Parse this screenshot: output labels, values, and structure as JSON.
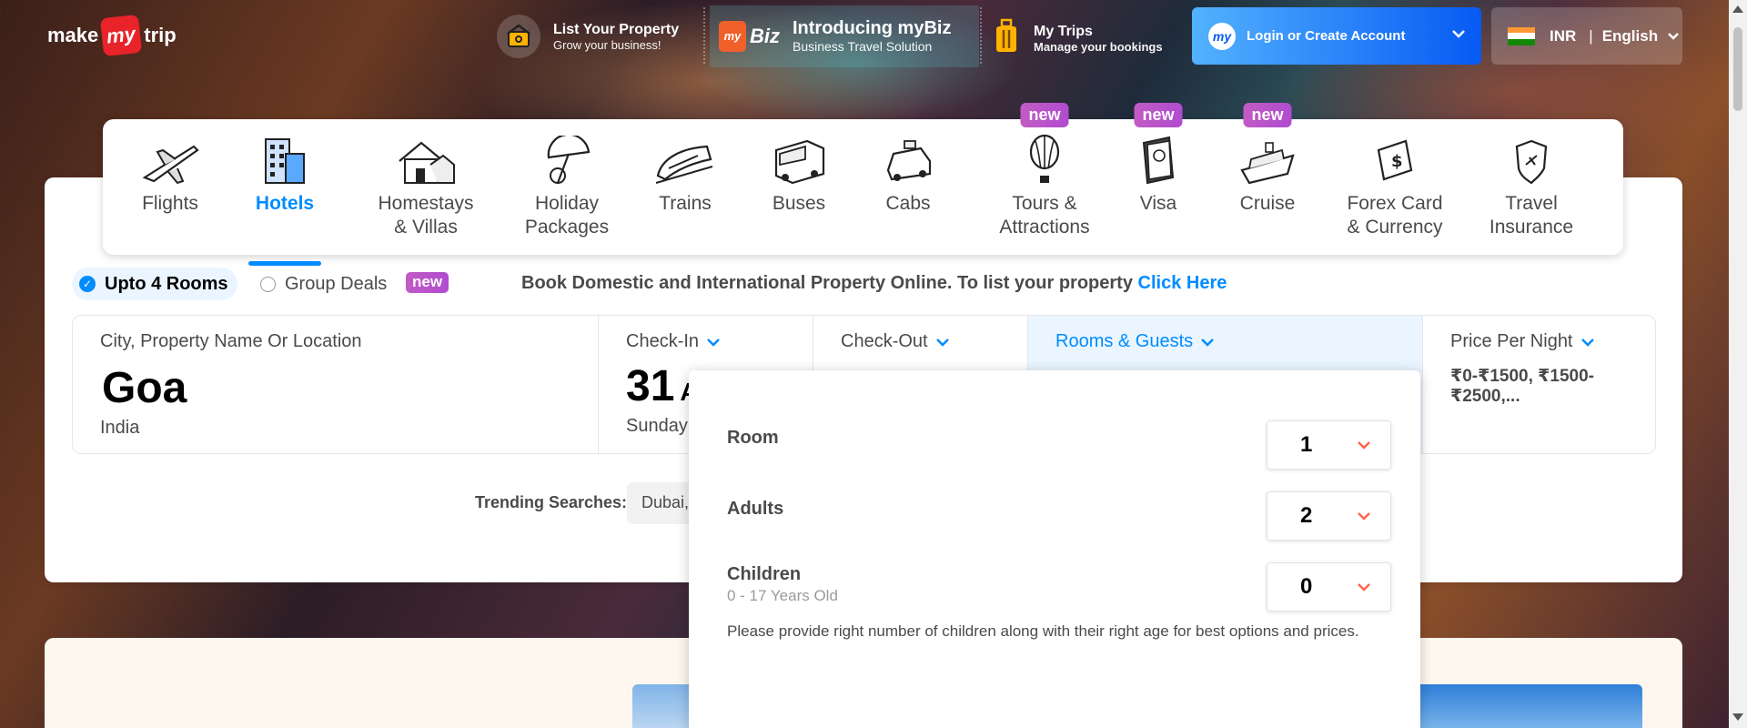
{
  "header": {
    "logo_left": "make",
    "logo_mid": "my",
    "logo_right": "trip",
    "list_property": {
      "title": "List Your Property",
      "subtitle": "Grow your business!"
    },
    "mybiz": {
      "badge": "Biz",
      "title": "Introducing myBiz",
      "subtitle": "Business Travel Solution"
    },
    "my_trips": {
      "title": "My Trips",
      "subtitle": "Manage your bookings"
    },
    "login": {
      "label": "Login or Create Account",
      "icon_text": "my"
    },
    "locale": {
      "currency": "INR",
      "separator": "|",
      "language": "English"
    }
  },
  "nav": {
    "items": [
      {
        "label1": "Flights",
        "label2": "",
        "icon": "plane-icon"
      },
      {
        "label1": "Hotels",
        "label2": "",
        "icon": "hotel-icon"
      },
      {
        "label1": "Homestays",
        "label2": "& Villas",
        "icon": "house-icon"
      },
      {
        "label1": "Holiday",
        "label2": "Packages",
        "icon": "umbrella-icon"
      },
      {
        "label1": "Trains",
        "label2": "",
        "icon": "train-icon"
      },
      {
        "label1": "Buses",
        "label2": "",
        "icon": "bus-icon"
      },
      {
        "label1": "Cabs",
        "label2": "",
        "icon": "cab-icon"
      },
      {
        "label1": "Tours &",
        "label2": "Attractions",
        "icon": "balloon-icon",
        "badge": "new"
      },
      {
        "label1": "Visa",
        "label2": "",
        "icon": "passport-icon",
        "badge": "new"
      },
      {
        "label1": "Cruise",
        "label2": "",
        "icon": "cruise-icon",
        "badge": "new"
      },
      {
        "label1": "Forex Card",
        "label2": "& Currency",
        "icon": "forex-icon"
      },
      {
        "label1": "Travel",
        "label2": "Insurance",
        "icon": "insurance-icon"
      }
    ],
    "active": "Hotels"
  },
  "options": {
    "upto_rooms": "Upto 4 Rooms",
    "group_deals": "Group Deals",
    "group_new": "new",
    "promo_text": "Book Domestic and International Property Online. To list your property",
    "promo_link": "Click Here"
  },
  "search": {
    "city_label": "City, Property Name Or Location",
    "city_value": "Goa",
    "city_country": "India",
    "checkin_label": "Check-In",
    "checkin_day": "31",
    "checkin_month_partial": "A",
    "checkin_weekday": "Sunday",
    "checkout_label": "Check-Out",
    "rooms_label": "Rooms & Guests",
    "price_label": "Price Per Night",
    "price_value": "₹0-₹1500, ₹1500-₹2500,..."
  },
  "trending": {
    "label": "Trending Searches:",
    "chip": "Dubai,"
  },
  "guests_dropdown": {
    "room_label": "Room",
    "room_value": "1",
    "adults_label": "Adults",
    "adults_value": "2",
    "children_label": "Children",
    "children_sub": "0 - 17 Years Old",
    "children_value": "0",
    "note": "Please provide right number of children along with their right age for best options and prices."
  },
  "colors": {
    "accent": "#008cff",
    "brand_red": "#e8232a",
    "new_badge": "#b04cd0",
    "chevron_orange": "#ff664b"
  }
}
